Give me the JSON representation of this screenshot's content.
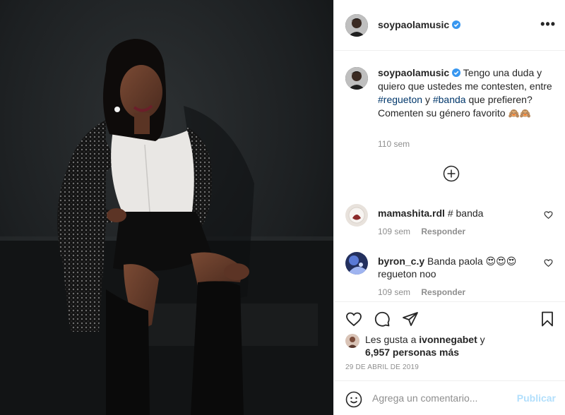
{
  "post": {
    "username": "soypaolamusic",
    "verified": true,
    "more_icon": "more-options-icon",
    "photo_description_icon": "photo"
  },
  "caption": {
    "username": "soypaolamusic",
    "text_1": "Tengo una duda y quiero que ustedes me contesten, entre",
    "tag_1": "#regueton",
    "text_2": "y",
    "tag_2": "#banda",
    "text_3": "que prefieren?",
    "text_4": "Comenten su género favorito",
    "emojis": "🙈🙈",
    "time": "110 sem"
  },
  "load_more_icon": "plus-circle-icon",
  "comments": [
    {
      "username": "mamashita.rdl",
      "text": "# banda",
      "time": "109 sem",
      "reply": "Responder"
    },
    {
      "username": "byron_c.y",
      "text": "Banda paola 😍😍😍 regueton noo",
      "time": "109 sem",
      "reply": "Responder"
    }
  ],
  "likes": {
    "prefix": "Les gusta a",
    "user": "ivonnegabet",
    "conj": "y",
    "count_text": "6,957 personas más"
  },
  "date": "29 DE ABRIL DE 2019",
  "composer": {
    "placeholder": "Agrega un comentario...",
    "publish": "Publicar"
  },
  "colors": {
    "accent_link": "#00376b",
    "verified": "#3897f0",
    "publish_disabled": "#b2dffc",
    "muted": "#8e8e8e"
  }
}
